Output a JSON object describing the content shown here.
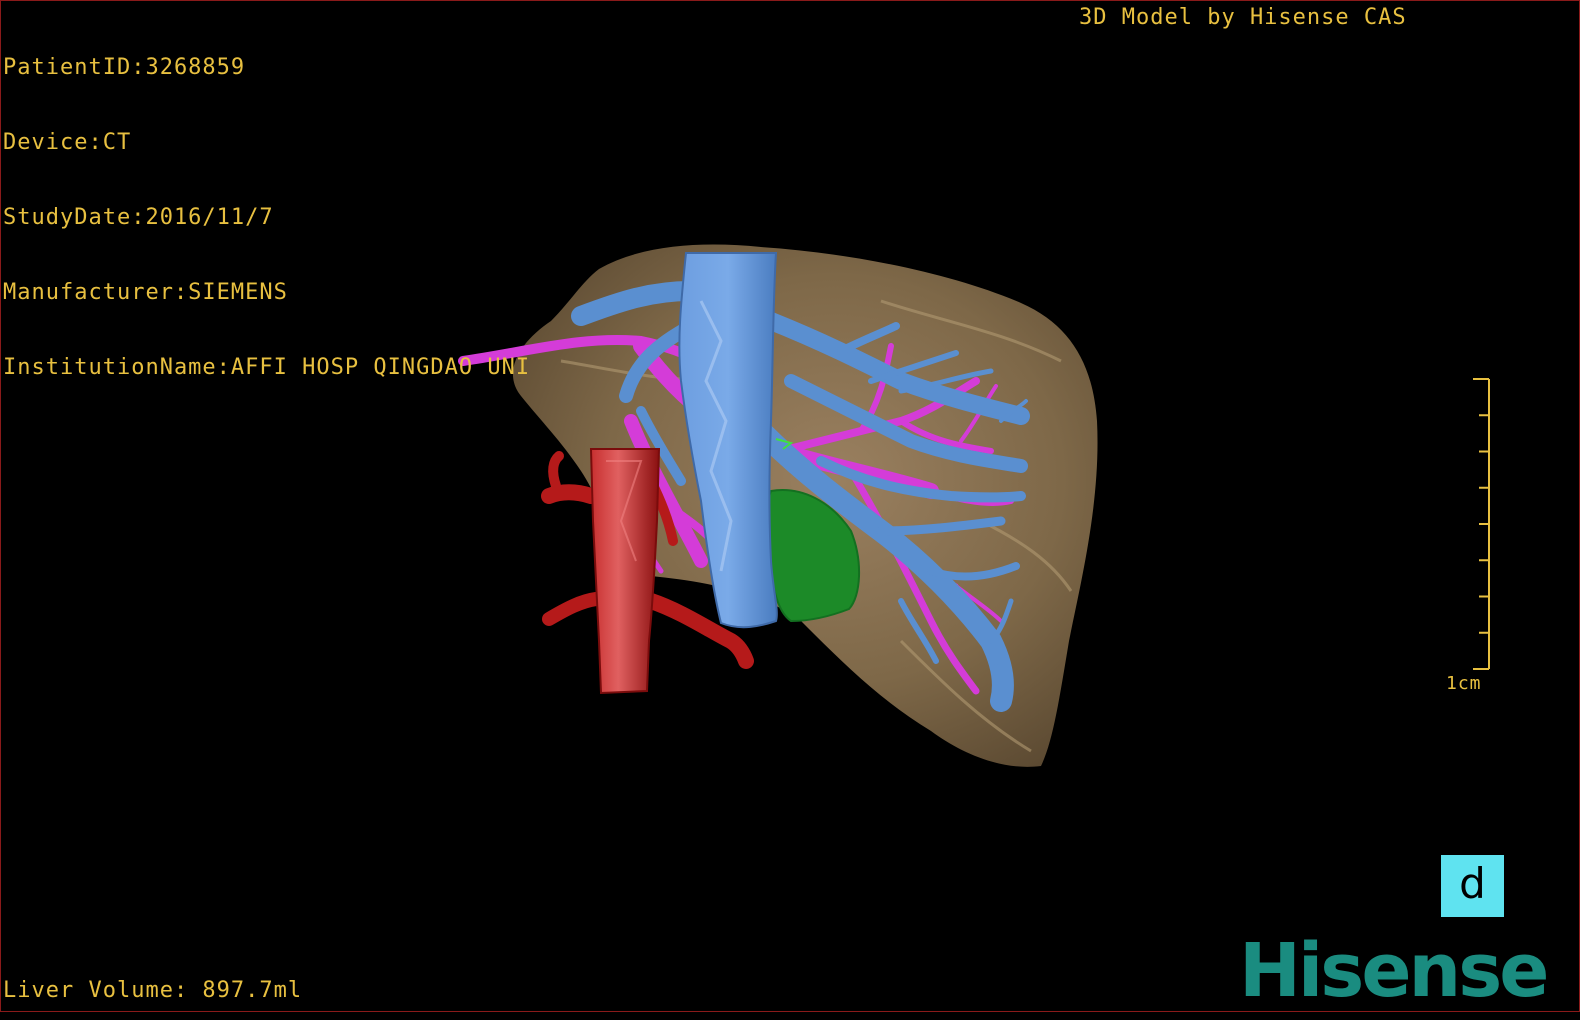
{
  "patient_info": [
    "PatientID:3268859",
    "Device:CT",
    "StudyDate:2016/11/7",
    "Manufacturer:SIEMENS",
    "InstitutionName:AFFI HOSP QINGDAO UNI"
  ],
  "model_credit": "3D Model by Hisense CAS",
  "liver_volume": "Liver Volume: 897.7ml",
  "scale": {
    "label": "1cm",
    "tick_count": 9
  },
  "orientation_marker": {
    "label": "d"
  },
  "brand": "Hisense",
  "colors": {
    "overlay_text": "#e8c040",
    "liver": "#8a7250",
    "hepatic_vein": "#5a8fd0",
    "portal_vein": "#d43cd8",
    "artery": "#b51a1a",
    "lesion": "#1c8a28",
    "orientation_bg": "#5fe3f0",
    "brand": "#1a8c80"
  }
}
